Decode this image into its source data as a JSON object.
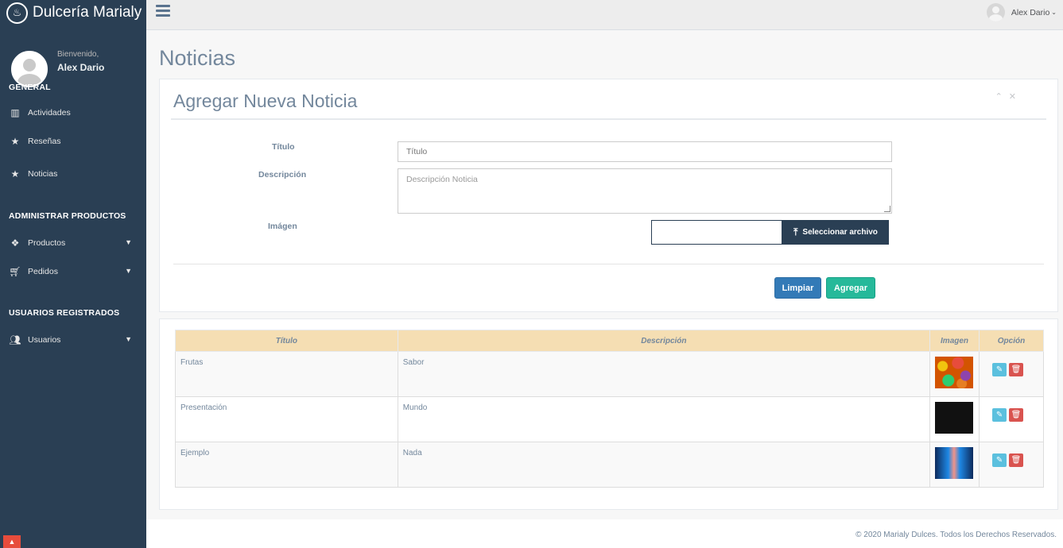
{
  "app": {
    "brand_title": "Dulcería Marialy",
    "brand_icon": "cake-icon"
  },
  "profile": {
    "welcome": "Bienvenido,",
    "name": "Alex Dario"
  },
  "sidebar": {
    "sections": [
      {
        "title": "GENERAL",
        "items": [
          {
            "label": "Actividades",
            "icon": "bar-chart-icon"
          },
          {
            "label": "Reseñas",
            "icon": "star-icon"
          },
          {
            "label": "Noticias",
            "icon": "star-icon"
          }
        ]
      },
      {
        "title": "ADMINISTRAR PRODUCTOS",
        "items": [
          {
            "label": "Productos",
            "icon": "dropbox-icon"
          },
          {
            "label": "Pedidos",
            "icon": "cart-icon"
          }
        ]
      },
      {
        "title": "USUARIOS REGISTRADOS",
        "items": [
          {
            "label": "Usuarios",
            "icon": "users-icon"
          }
        ]
      }
    ]
  },
  "topnav": {
    "user_name": "Alex Dario"
  },
  "page": {
    "title": "Noticias"
  },
  "form": {
    "title": "Agregar Nueva Noticia",
    "title_label": "Título",
    "title_placeholder": "Título",
    "description_label": "Descripción",
    "description_placeholder": "Descripción Noticia",
    "image_label": "Imágen",
    "file_button": "Seleccionar archivo",
    "clear_button": "Limpiar",
    "add_button": "Agregar"
  },
  "table": {
    "headers": [
      "Título",
      "Descripción",
      "Imagen",
      "Opción"
    ],
    "rows": [
      {
        "title": "Frutas",
        "description": "Sabor"
      },
      {
        "title": "Presentación",
        "description": "Mundo"
      },
      {
        "title": "Ejemplo",
        "description": "Nada"
      }
    ]
  },
  "footer": {
    "text": "© 2020 Marialy Dulces. Todos los Derechos Reservados."
  },
  "colors": {
    "sidebar_bg": "#2a3f54",
    "table_header_bg": "#f5deb3",
    "clear_btn": "#337ab7",
    "add_btn": "#26b99a",
    "edit_btn": "#5bc0de",
    "delete_btn": "#d9534f"
  }
}
